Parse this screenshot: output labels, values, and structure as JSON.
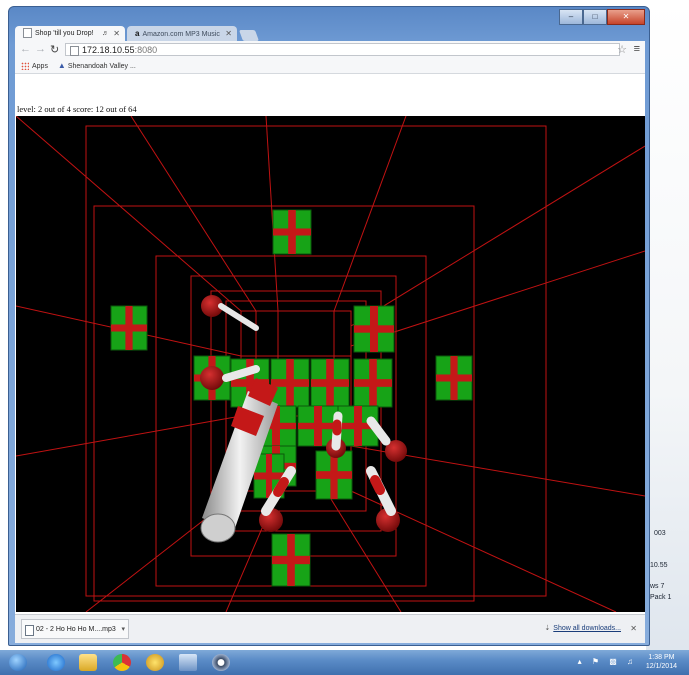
{
  "browser": {
    "tabs": [
      {
        "title": "Shop 'till you Drop!",
        "active": true
      },
      {
        "title": "Amazon.com MP3 Music",
        "active": false
      }
    ],
    "url_host": "172.18.10.55",
    "url_port": ":8080",
    "bookmarks": {
      "apps_label": "Apps",
      "item": "Shenandoah Valley ..."
    }
  },
  "game": {
    "status": "level: 2 out of 4   score: 12 out of 64",
    "colors": {
      "grid": "#cc1010",
      "gift_green": "#17a317",
      "ribbon_red": "#c41818",
      "cane_white": "#e8e8e8"
    }
  },
  "downloads": {
    "file": "02 - 2 Ho Ho Ho M....mp3",
    "show_all": "Show all downloads..."
  },
  "desktop_peek": {
    "lines": [
      "003",
      "10.55",
      "ws 7",
      "Pack 1"
    ]
  },
  "taskbar": {
    "time": "1:38 PM",
    "date": "12/1/2014",
    "icons": [
      "start-orb-icon",
      "ie-icon",
      "explorer-folder-icon",
      "chrome-icon",
      "network-icon",
      "screenshot-icon",
      "vpn-icon"
    ]
  }
}
